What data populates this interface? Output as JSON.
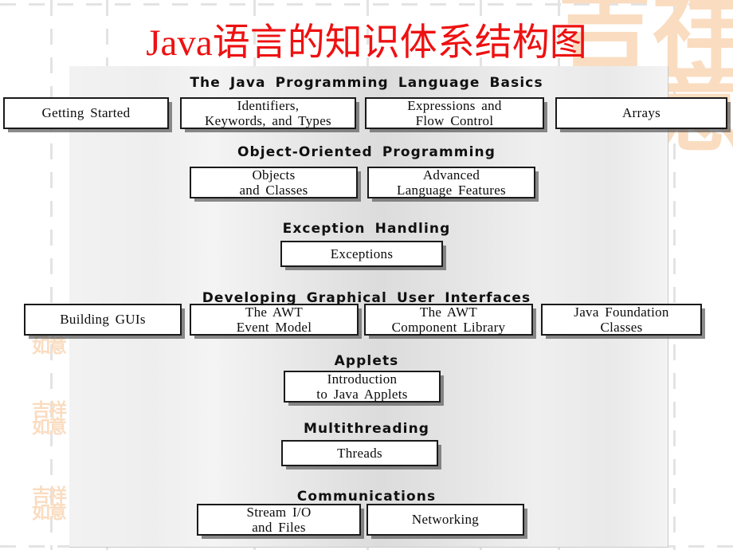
{
  "slide": {
    "title": "Java语言的知识体系结构图",
    "title_color": "#ee1111",
    "background_color": "#ffffff",
    "panel_note": "gradient gray panel"
  },
  "watermarks": {
    "corner_seal_text": "吉祥\n如意",
    "side_seal_text": "吉祥\n如意",
    "color": "#fadcc0"
  },
  "sections": [
    {
      "heading": "The  Java  Programming  Language  Basics",
      "boxes": [
        {
          "label": "Getting  Started"
        },
        {
          "label": "Identifiers,\nKeywords, and  Types"
        },
        {
          "label": "Expressions  and\nFlow  Control"
        },
        {
          "label": "Arrays"
        }
      ]
    },
    {
      "heading": "Object-Oriented  Programming",
      "boxes": [
        {
          "label": "Objects\nand  Classes"
        },
        {
          "label": "Advanced\nLanguage  Features"
        }
      ]
    },
    {
      "heading": "Exception  Handling",
      "boxes": [
        {
          "label": "Exceptions"
        }
      ]
    },
    {
      "heading": "Developing  Graphical  User  Interfaces",
      "boxes": [
        {
          "label": "Building  GUIs"
        },
        {
          "label": "The  AWT\nEvent  Model"
        },
        {
          "label": "The  AWT\nComponent  Library"
        },
        {
          "label": "Java  Foundation\nClasses"
        }
      ]
    },
    {
      "heading": "Applets",
      "boxes": [
        {
          "label": "Introduction\nto  Java  Applets"
        }
      ]
    },
    {
      "heading": "Multithreading",
      "boxes": [
        {
          "label": "Threads"
        }
      ]
    },
    {
      "heading": "Communications",
      "boxes": [
        {
          "label": "Stream  I/O\nand  Files"
        },
        {
          "label": "Networking"
        }
      ]
    }
  ]
}
